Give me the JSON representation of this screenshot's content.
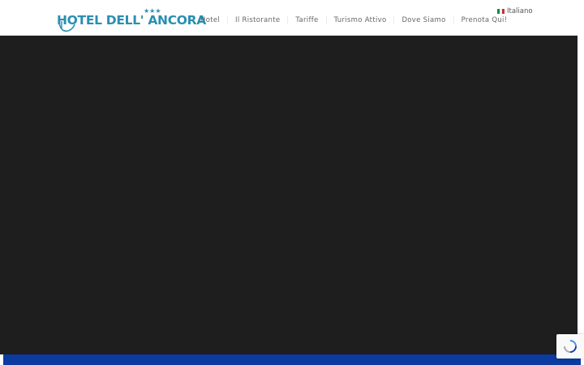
{
  "logo": {
    "text": "HOTEL DELL' ANCORA",
    "stars": "★★★"
  },
  "nav": {
    "items": [
      {
        "label": "Hotel"
      },
      {
        "label": "Il Ristorante"
      },
      {
        "label": "Tariffe"
      },
      {
        "label": "Turismo Attivo"
      },
      {
        "label": "Dove Siamo"
      },
      {
        "label": "Prenota Qui!"
      }
    ]
  },
  "language": {
    "label": "Italiano",
    "flag_colors": [
      "#009246",
      "#ffffff",
      "#ce2b37"
    ]
  },
  "colors": {
    "brand": "#2a8fb0",
    "hero_bg": "#1e1e1e",
    "bottom_bar": "#0b3aa0"
  }
}
